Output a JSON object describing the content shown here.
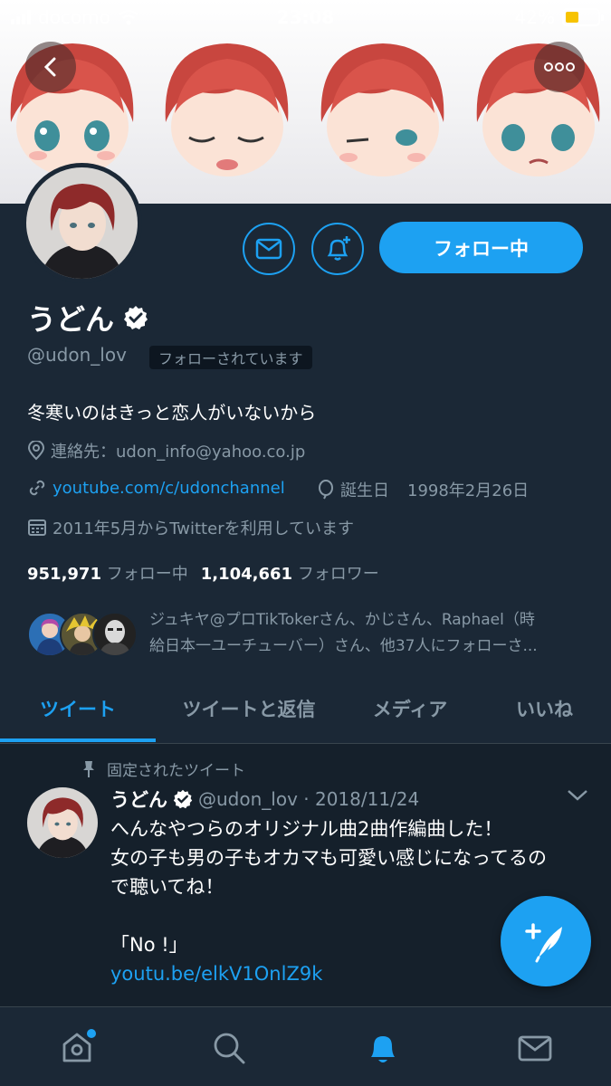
{
  "status_bar": {
    "carrier": "docomo",
    "time": "23:08",
    "battery": "42%",
    "battery_level": 0.42
  },
  "header": {
    "back_icon": "chevron-left-icon",
    "more_icon": "more-horizontal-icon"
  },
  "profile": {
    "display_name": "うどん",
    "handle": "@udon_lov",
    "follows_you_label": "フォローされています",
    "follow_button_label": "フォロー中",
    "bio": "冬寒いのはきっと恋人がいないから",
    "location": "連絡先：udon_info@yahoo.co.jp",
    "website": "youtube.com/c/udonchannel",
    "birthday_label": "誕生日",
    "birthday": "1998年2月26日",
    "joined": "2011年5月からTwitterを利用しています",
    "following_count": "951,971",
    "following_label": "フォロー中",
    "followers_count": "1,104,661",
    "followers_label": "フォロワー",
    "followed_by_line1": "ジュキヤ@プロTikTokerさん、かじさん、Raphael（時",
    "followed_by_line2": "給日本一ユーチューバー）さん、他37人にフォローさ..."
  },
  "tabs": [
    {
      "label": "ツイート",
      "active": true
    },
    {
      "label": "ツイートと返信",
      "active": false
    },
    {
      "label": "メディア",
      "active": false
    },
    {
      "label": "いいね",
      "active": false
    }
  ],
  "tweet": {
    "pinned_label": "固定されたツイート",
    "name": "うどん",
    "handle_date": "@udon_lov · 2018/11/24",
    "line1": "へんなやつらのオリジナル曲2曲作編曲した！",
    "line2": "女の子も男の子もオカマも可愛い感じになってるの",
    "line3": "で聴いてね！",
    "line4": "「No !」",
    "link": "youtu.be/elkV1OnlZ9k"
  },
  "colors": {
    "accent": "#1da1f2",
    "background": "#1b2836",
    "tweet_bg": "#15202b",
    "muted": "#8899a6"
  },
  "bottom_nav": [
    "home-icon",
    "search-icon",
    "notifications-icon",
    "messages-icon"
  ]
}
